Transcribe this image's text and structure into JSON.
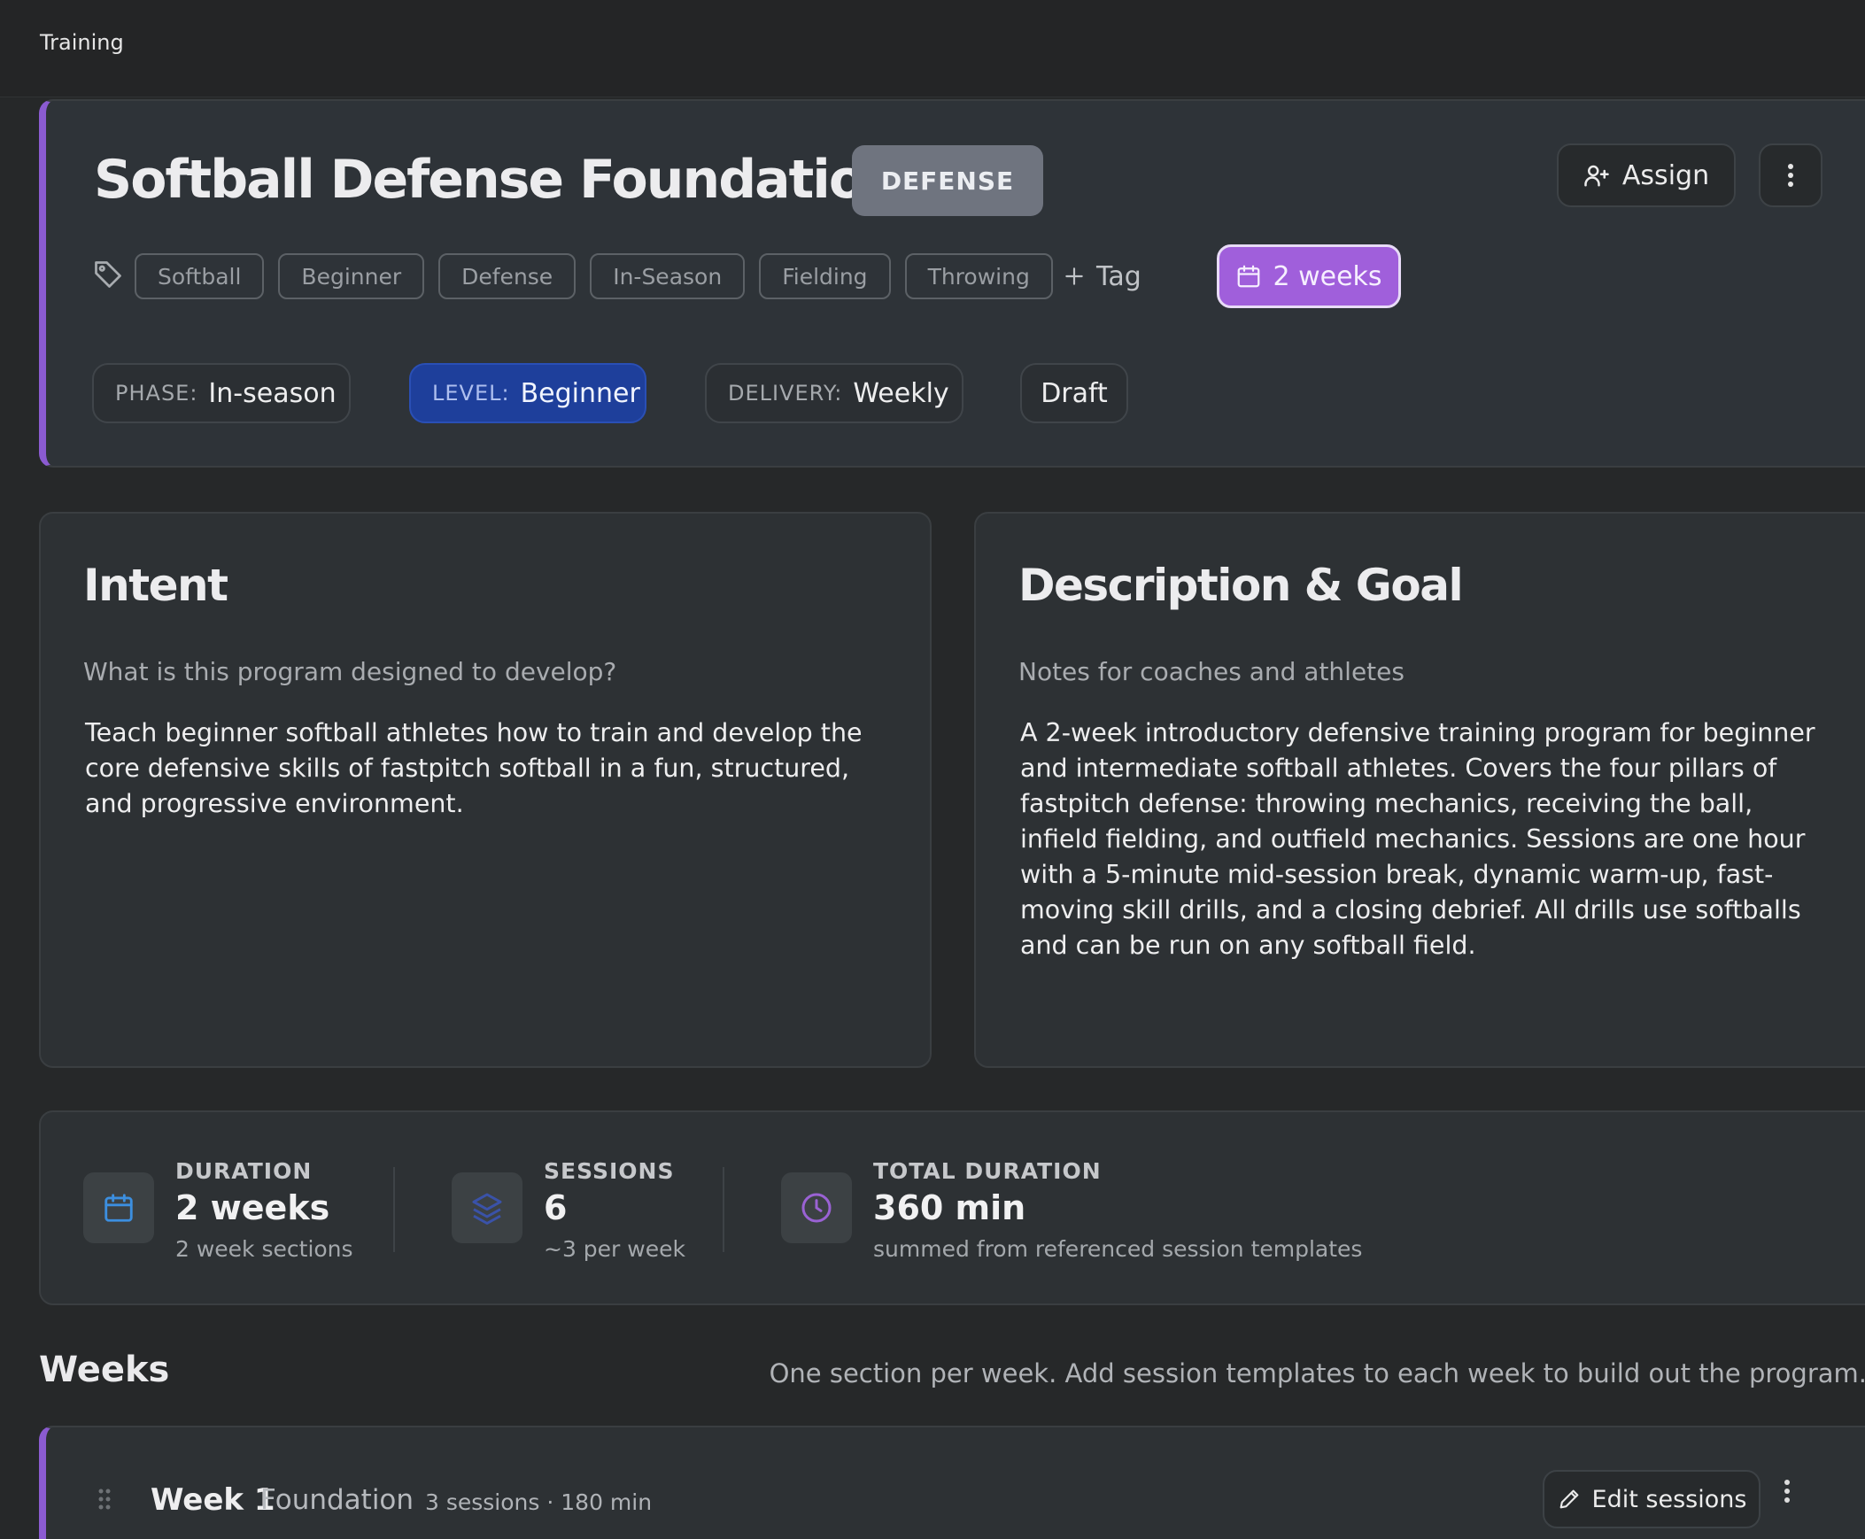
{
  "breadcrumb": "Training",
  "program": {
    "title": "Softball Defense Foundations",
    "category_badge": "DEFENSE",
    "assign_label": "Assign",
    "tags": [
      "Softball",
      "Beginner",
      "Defense",
      "In-Season",
      "Fielding",
      "Throwing"
    ],
    "add_tag_label": "Tag",
    "duration_pill": "2 weeks",
    "meta": {
      "phase_key": "PHASE:",
      "phase_value": "In-season",
      "level_key": "LEVEL:",
      "level_value": "Beginner",
      "delivery_key": "DELIVERY:",
      "delivery_value": "Weekly",
      "status": "Draft"
    }
  },
  "intent": {
    "title": "Intent",
    "subtitle": "What is this program designed to develop?",
    "body": "Teach beginner softball athletes how to train and develop the core defensive skills of fastpitch softball in a fun, structured, and progressive environment."
  },
  "description": {
    "title": "Description & Goal",
    "subtitle": "Notes for coaches and athletes",
    "body": "A 2-week introductory defensive training program for beginner and intermediate softball athletes. Covers the four pillars of fastpitch defense: throwing mechanics, receiving the ball, infield fielding, and outfield mechanics. Sessions are one hour with a 5-minute mid-session break, dynamic warm-up, fast-moving skill drills, and a closing debrief. All drills use softballs and can be run on any softball field."
  },
  "stats": {
    "duration": {
      "label": "DURATION",
      "value": "2 weeks",
      "sub": "2 week sections"
    },
    "sessions": {
      "label": "SESSIONS",
      "value": "6",
      "sub": "~3 per week"
    },
    "total": {
      "label": "TOTAL DURATION",
      "value": "360 min",
      "sub": "summed from referenced session templates"
    }
  },
  "weeks": {
    "title": "Weeks",
    "hint": "One section per week. Add session templates to each week to build out the program.",
    "items": [
      {
        "name": "Week 1",
        "theme": "Foundation",
        "meta": "3 sessions · 180 min",
        "edit_label": "Edit sessions"
      }
    ]
  },
  "colors": {
    "accent": "#8b5bd1",
    "pill": "#a05fdb",
    "level": "#1e3f9b"
  }
}
